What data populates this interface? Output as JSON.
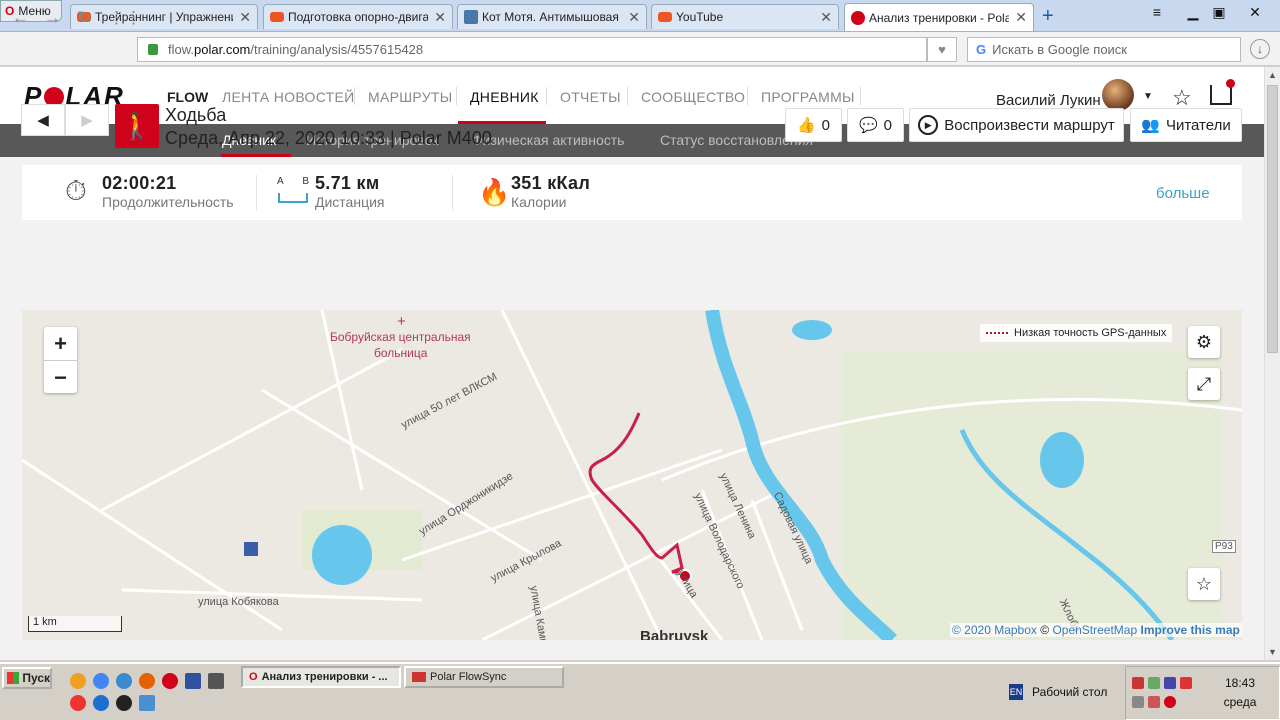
{
  "browser": {
    "menu_label": "Меню",
    "tabs": [
      {
        "title": "Трейраннинг | Упражнения"
      },
      {
        "title": "Подготовка опорно-двигат"
      },
      {
        "title": "Кот Мотя. Антимышовая ко"
      },
      {
        "title": "YouTube"
      },
      {
        "title": "Анализ тренировки - Polar F"
      }
    ],
    "url_host": "flow.",
    "url_domain": "polar.com",
    "url_path": "/training/analysis/4557615428",
    "search_placeholder": "Искать в Google поиск"
  },
  "header": {
    "logo_text": "POLAR",
    "flow_label": "FLOW",
    "nav": [
      "ЛЕНТА НОВОСТЕЙ",
      "МАРШРУТЫ",
      "ДНЕВНИК",
      "ОТЧЕТЫ",
      "СООБЩЕСТВО",
      "ПРОГРАММЫ"
    ],
    "user_name": "Василий Лукин"
  },
  "subnav": [
    "Дневник",
    "История тренировок",
    "Физическая активность",
    "Статус восстановления"
  ],
  "training": {
    "sport": "Ходьба",
    "date_line": "Среда, Апр 22, 2020 10:33 | Polar M400",
    "likes": "0",
    "comments": "0",
    "replay_label": "Воспроизвести маршрут",
    "followers_label": "Читатели"
  },
  "summary": {
    "duration_value": "02:00:21",
    "duration_label": "Продолжительность",
    "distance_value": "5.71 км",
    "distance_label": "Дистанция",
    "distance_a": "A",
    "distance_b": "B",
    "calories_value": "351 кКал",
    "calories_label": "Калории",
    "more_label": "больше"
  },
  "map": {
    "legend": "Низкая точность GPS-данных",
    "scale_label": "1 km",
    "attribution_1": "© 2020 Mapbox",
    "attribution_2": "©",
    "attribution_3": "OpenStreetMap",
    "attribution_4": "Improve this map",
    "labels": {
      "hospital": "Бобруйская центральная",
      "hospital2": "больница",
      "street1": "улица 50 лет ВЛКСМ",
      "street2": "улица Орджоникидзе",
      "street3": "улица Крылова",
      "street4": "улица Кобякова",
      "street5": "улица Ленина",
      "street6": "улица Володарского",
      "street7": "Садовая улица",
      "street8": "улица",
      "street9": "улица Камы",
      "city": "Babruysk",
      "road": "P93",
      "village": "Жлоби"
    }
  },
  "taskbar": {
    "start_label": "Пуск",
    "tasks": [
      "Анализ тренировки - ...",
      "Polar FlowSync"
    ],
    "lang": "EN",
    "desktop_label": "Рабочий стол",
    "time": "18:43",
    "day": "среда"
  },
  "colors": {
    "brand_red": "#d0021b",
    "link_blue": "#3aa3c8",
    "route": "#c8204a",
    "water": "#66c6ec"
  }
}
